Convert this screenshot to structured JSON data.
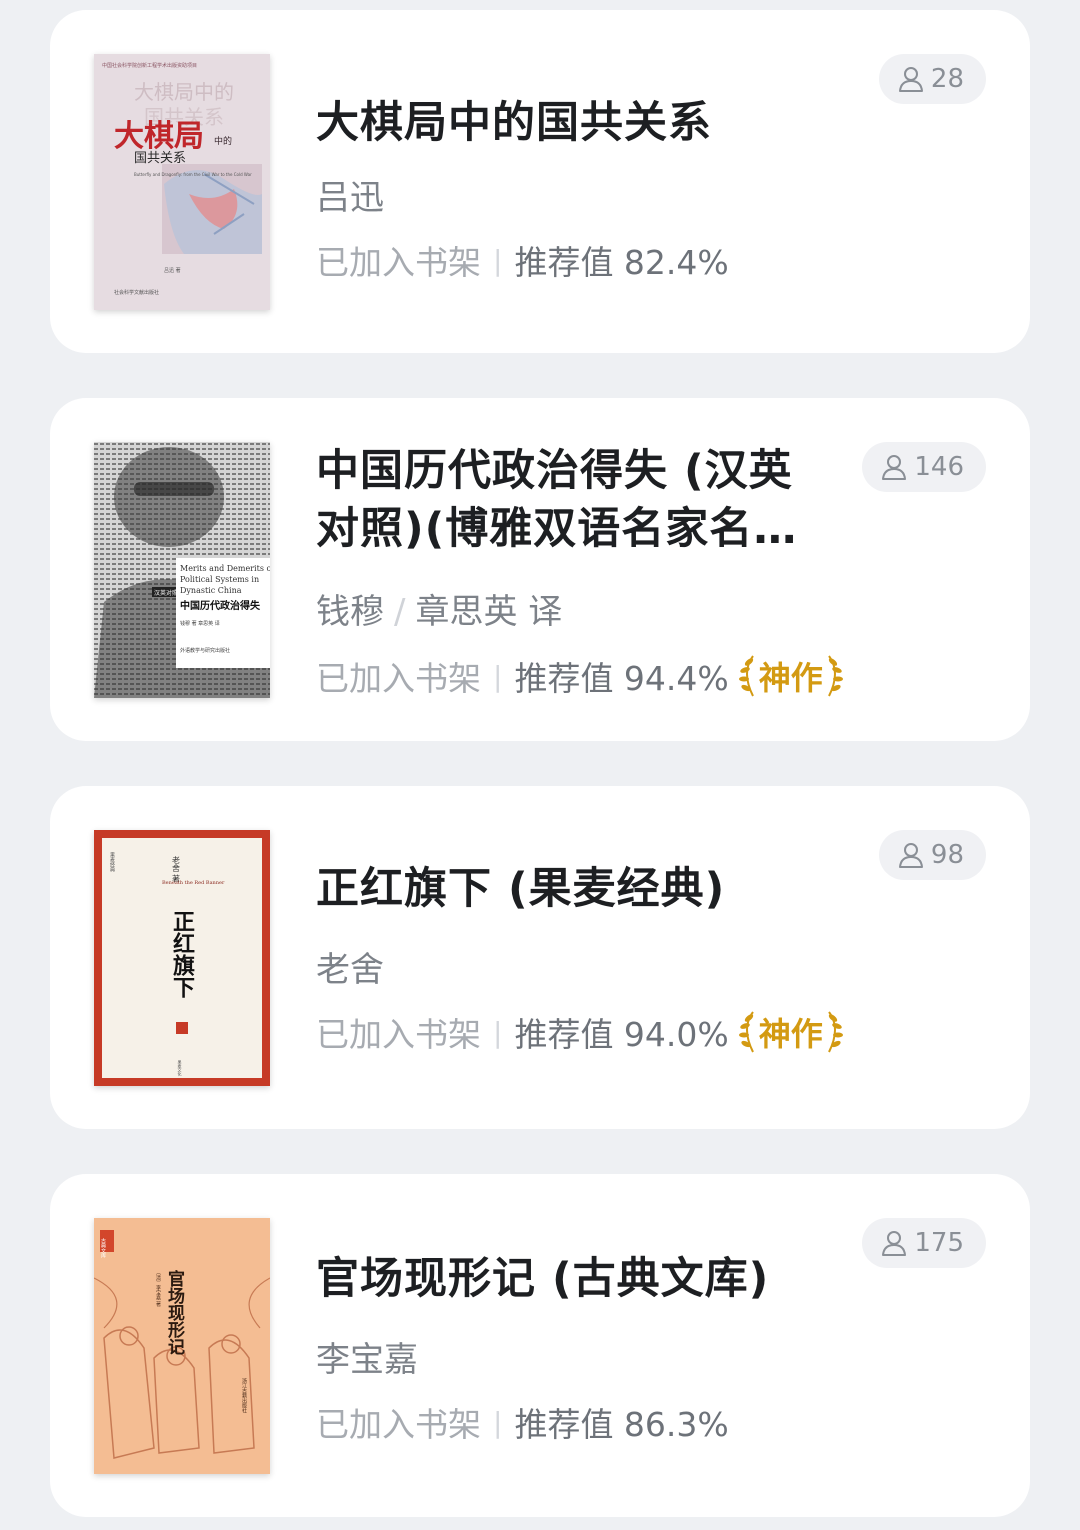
{
  "books": [
    {
      "title": "大棋局中的国共关系",
      "author": "吕迅",
      "translator": "",
      "shelf_status": "已加入书架",
      "recommend": "推荐值 82.4%",
      "badge": "",
      "readers": "28",
      "cover": {
        "style": "gray-pink map",
        "top_text": "中国社会科学院创新工程学术出版资助项目",
        "title_big": "大棋局",
        "title_small": "中的",
        "title_line2": "国共关系",
        "subtitle": "Butterfly and Dragonfly: from the Civil War to the Cold War",
        "author": "吕迅 著",
        "publisher": "社会科学文献出版社"
      }
    },
    {
      "title": "中国历代政治得失 (汉英对照)(博雅双语名家名作)",
      "author": "钱穆",
      "translator": "章思英 译",
      "shelf_status": "已加入书架",
      "recommend": "推荐值 94.4%",
      "badge": "神作",
      "readers": "146",
      "cover": {
        "style": "portrait text",
        "en_title_1": "Merits and Demerits of",
        "en_title_2": "Political Systems in",
        "en_title_3": "Dynastic China",
        "series": "汉英对照",
        "cn_title": "中国历代政治得失",
        "author": "钱穆 著  章思英 译",
        "publisher": "外语教学与研究出版社"
      }
    },
    {
      "title": "正红旗下 (果麦经典)",
      "author": "老舍",
      "translator": "",
      "shelf_status": "已加入书架",
      "recommend": "推荐值 94.0%",
      "badge": "神作",
      "readers": "98",
      "cover": {
        "style": "red frame",
        "author": "老舍 著",
        "en_title": "Beneath the Red Banner",
        "cn_title": "正红旗下",
        "side": "果麦经典"
      }
    },
    {
      "title": "官场现形记 (古典文库)",
      "author": "李宝嘉",
      "translator": "",
      "shelf_status": "已加入书架",
      "recommend": "推荐值 86.3%",
      "badge": "",
      "readers": "175",
      "cover": {
        "style": "orange sketch",
        "cn_title": "官场现形记",
        "author": "〔清〕李宝嘉 著",
        "seal": "古典文库",
        "publisher": "浙江古籍出版社"
      }
    }
  ],
  "colors": {
    "background": "#eef0f3",
    "card": "#ffffff",
    "badge": "#d39a12",
    "title": "#1d1f22"
  },
  "icons": {
    "readers": "person-icon",
    "badge": "laurel-icon"
  }
}
